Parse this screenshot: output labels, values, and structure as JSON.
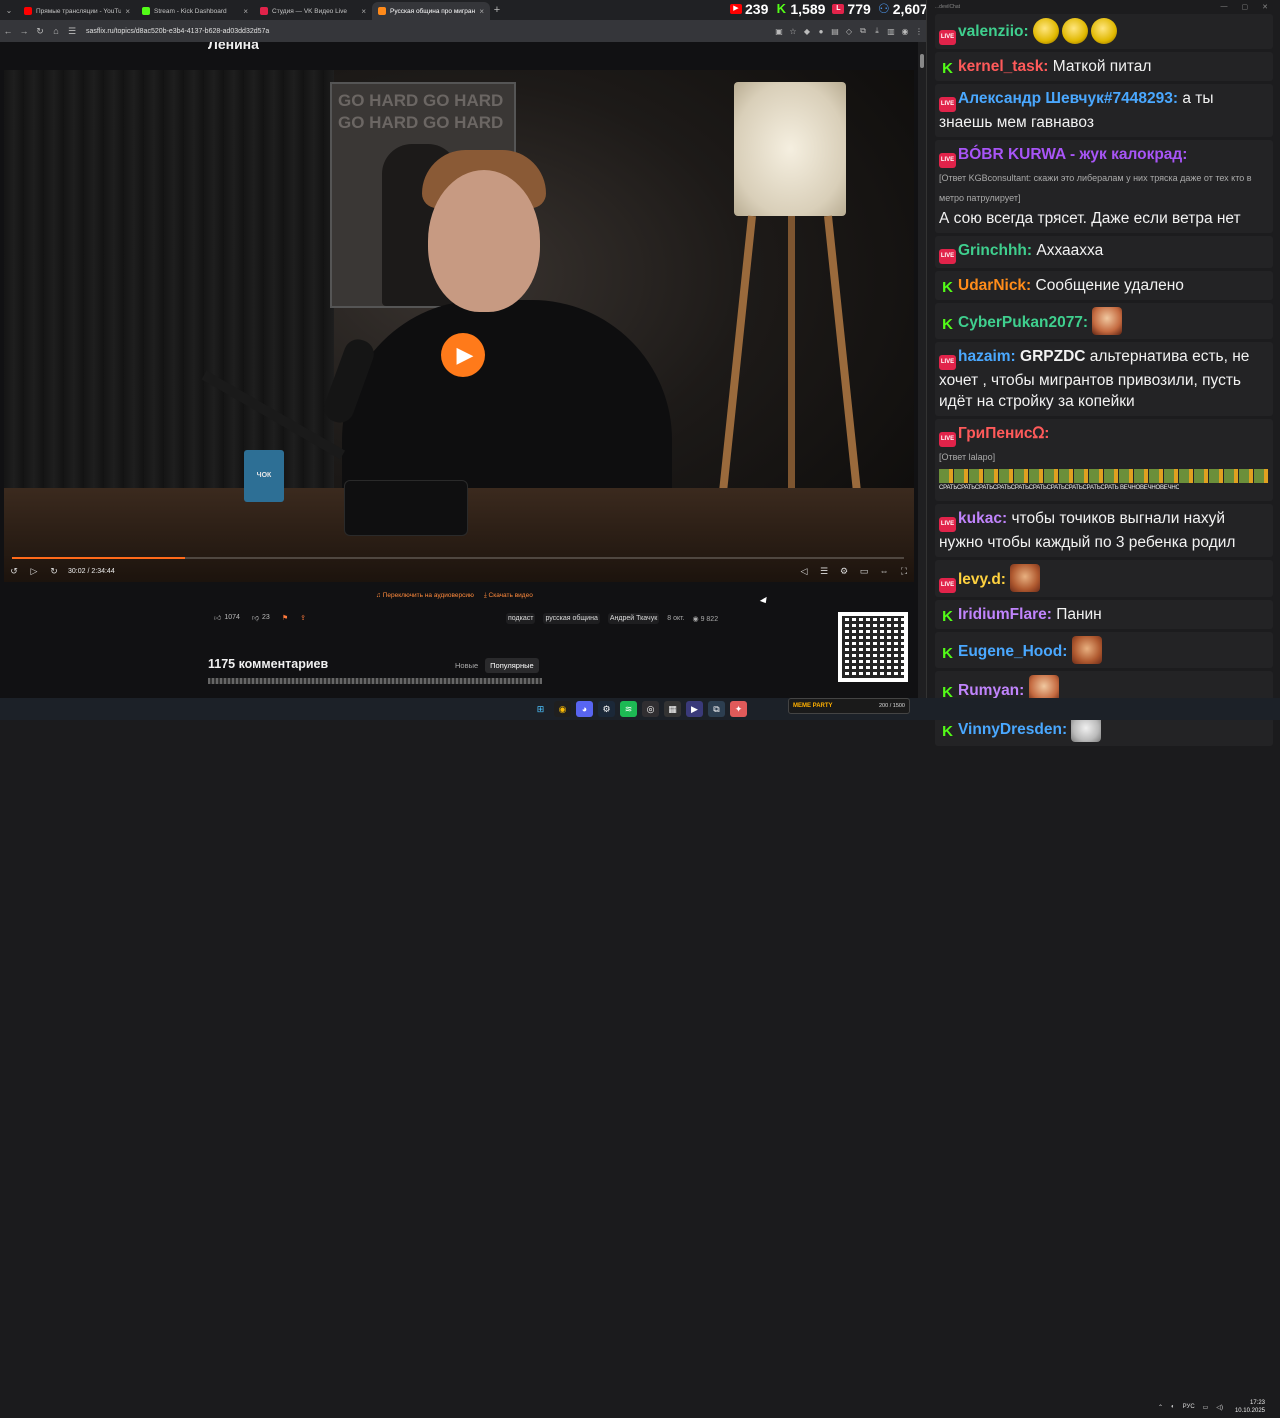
{
  "browser": {
    "tabs": [
      {
        "title": "Прямые трансляции - YouTube",
        "fav_color": "#ff0000",
        "active": false
      },
      {
        "title": "Stream - Kick Dashboard",
        "fav_color": "#53fc18",
        "active": false
      },
      {
        "title": "Студия — VK Видео Live",
        "fav_color": "#e1234a",
        "active": false
      },
      {
        "title": "Русская община про мигрант",
        "fav_color": "#ff8a1a",
        "active": true
      }
    ],
    "url": "sasflix.ru/topics/d8ac520b-e3b4-4137-b628-ad03dd32d57a",
    "stats": [
      {
        "platform": "youtube-icon",
        "value": "239",
        "color": "#ff0000"
      },
      {
        "platform": "kick-icon",
        "value": "1,589",
        "color": "#53fc18"
      },
      {
        "platform": "vk-live-icon",
        "value": "779",
        "color": "#e1234a"
      },
      {
        "platform": "viewers-icon",
        "value": "2,607",
        "color": "#4a90e2"
      }
    ]
  },
  "page": {
    "heading": "Ленина",
    "video": {
      "poster_text": "GO HARD GO HARD GO HARD GO HARD",
      "mug_label": "ЧОК",
      "time": "30:02 / 2:34:44",
      "progress": 0.194,
      "accent": "#ff6a1a"
    },
    "actions": {
      "audio_switch": "Переключить на аудиоверсию",
      "download": "Скачать видео"
    },
    "reactions": {
      "likes": "1074",
      "dislikes": "23"
    },
    "tags": [
      "подкаст",
      "русская община",
      "Андрей Ткачук"
    ],
    "date": "8 окт.",
    "views": "9 822",
    "comments": {
      "title": "1175 комментариев",
      "sort_new": "Новые",
      "sort_popular": "Популярные"
    }
  },
  "chat": {
    "window_title": "...devilChat",
    "messages": [
      {
        "badge": "vk",
        "nick": "valenziio:",
        "nick_color": "#3fcf8e",
        "text": "",
        "emotes": [
          "gold",
          "gold",
          "gold"
        ]
      },
      {
        "badge": "kick",
        "nick": "kernel_task:",
        "nick_color": "#ff5a5a",
        "text": "Маткой питал"
      },
      {
        "badge": "vk",
        "nick": "Александр Шевчук#7448293:",
        "nick_color": "#4aa8ff",
        "text": "а ты знаешь мем гавнавоз"
      },
      {
        "badge": "vk",
        "nick": "BÓBR KURWA - жук калокрад:",
        "nick_color": "#a855f7",
        "reply": "[Ответ KGBconsultant: скажи это либералам у них тряска даже от тех кто в метро патрулирует]",
        "text": "А сою всегда трясет. Даже если ветра нет"
      },
      {
        "badge": "vk",
        "nick": "Grinchhh:",
        "nick_color": "#3fcf8e",
        "text": "Аххааxха"
      },
      {
        "badge": "kick",
        "nick": "UdarNick:",
        "nick_color": "#ff8c1a",
        "text": "Сообщение удалено"
      },
      {
        "badge": "kick",
        "nick": "CyberPukan2077:",
        "nick_color": "#3fcf8e",
        "text": "",
        "emotes": [
          "face"
        ]
      },
      {
        "badge": "vk",
        "nick": "hazaim:",
        "nick_color": "#4aa8ff",
        "bold_prefix": "GRPZDC",
        "text": "альтернатива есть, не хочет , чтобы мигрантов привозили, пусть идёт на стройку за копейки"
      },
      {
        "badge": "vk",
        "nick": "ГриПенисᘯ:",
        "nick_color": "#ff5a5a",
        "reply": "[Ответ lalapo]",
        "text": "",
        "strip": "СРАТЬСРАТЬСРАТЬСРАТЬСРАТЬСРАТЬСРАТЬСРАТЬСРАТЬСРАТЬ ВЕЧНОВЕЧНОВЕЧНОВЕЧНОВЕЧНОВЕЧНОВЕЧНОВЕЧНОВЕЧНОВЕЧНО"
      },
      {
        "badge": "vk",
        "nick": "kukac:",
        "nick_color": "#c084fc",
        "text": "чтобы точиков выгнали нахуй нужно чтобы каждый по 3 ребенка родил"
      },
      {
        "badge": "vk",
        "nick": "levy.d:",
        "nick_color": "#ffd23f",
        "text": "",
        "emotes": [
          "emote"
        ]
      },
      {
        "badge": "kick",
        "nick": "IridiumFlare:",
        "nick_color": "#c084fc",
        "text": "Панин"
      },
      {
        "badge": "kick",
        "nick": "Eugene_Hood:",
        "nick_color": "#4aa8ff",
        "text": "",
        "emotes": [
          "emote"
        ]
      },
      {
        "badge": "kick",
        "nick": "Rumyan:",
        "nick_color": "#c084fc",
        "text": "",
        "emotes": [
          "face"
        ]
      },
      {
        "badge": "kick",
        "nick": "VinnyDresden:",
        "nick_color": "#4aa8ff",
        "text": "",
        "emotes": [
          "rat"
        ]
      }
    ]
  },
  "taskbar": {
    "widget_title": "MEME PARTY",
    "widget_value": "200 / 1500",
    "lang": "РУС",
    "time": "17:23",
    "date": "10.10.2025"
  }
}
